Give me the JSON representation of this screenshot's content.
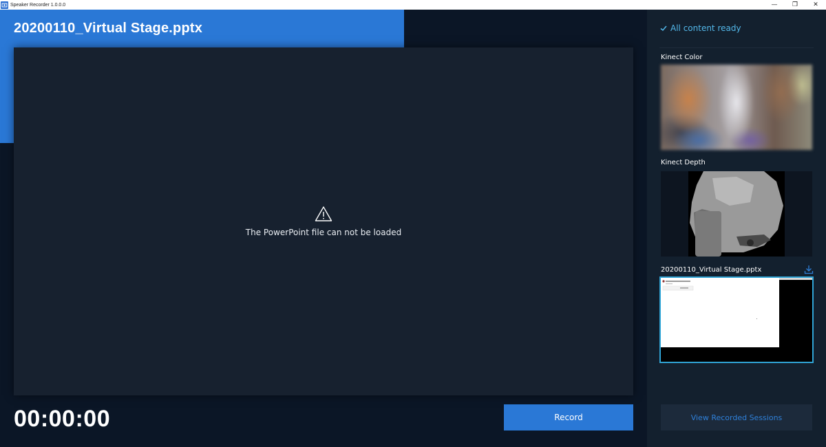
{
  "window": {
    "title": "Speaker Recorder 1.0.0.0",
    "minimize_glyph": "—",
    "restore_glyph": "❐",
    "close_glyph": "✕"
  },
  "main": {
    "document_title": "20200110_Virtual Stage.pptx",
    "error_message": "The PowerPoint file can not be loaded",
    "warning_icon": "warning-triangle-icon",
    "timer": "00:00:00",
    "record_label": "Record"
  },
  "side": {
    "status_text": "All content ready",
    "status_icon": "checkmark-icon",
    "kinect_color_label": "Kinect Color",
    "kinect_depth_label": "Kinect Depth",
    "pptx_label": "20200110_Virtual Stage.pptx",
    "pptx_action_icon": "download-icon",
    "view_sessions_label": "View Recorded Sessions"
  },
  "colors": {
    "accent_blue": "#2a78d6",
    "status_cyan": "#53b8ea",
    "background": "#0b1626",
    "stage": "#17212f",
    "side_panel": "#13202e"
  }
}
